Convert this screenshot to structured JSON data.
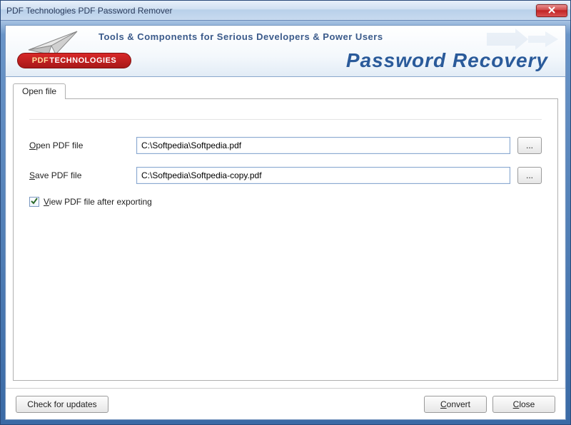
{
  "window": {
    "title": "PDF Technologies PDF Password Remover"
  },
  "banner": {
    "tagline": "Tools & Components for Serious Developers & Power Users",
    "title": "Password Recovery",
    "logo_prefix": "PDF",
    "logo_rest": "TECHNOLOGIES"
  },
  "tabs": {
    "openfile": {
      "label": "Open file"
    }
  },
  "form": {
    "open_label_pre": "O",
    "open_label_rest": "pen PDF file",
    "open_value": "C:\\Softpedia\\Softpedia.pdf",
    "save_label_pre": "S",
    "save_label_rest": "ave PDF file",
    "save_value": "C:\\Softpedia\\Softpedia-copy.pdf",
    "browse_label": "...",
    "view_after_checked": true,
    "view_after_pre": "V",
    "view_after_rest": "iew PDF file after exporting"
  },
  "footer": {
    "updates_label": "Check for updates",
    "convert_pre": "C",
    "convert_rest": "onvert",
    "close_pre": "C",
    "close_rest": "lose"
  }
}
